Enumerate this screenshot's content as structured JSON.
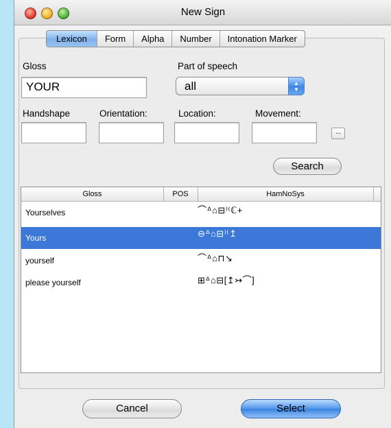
{
  "window": {
    "title": "New Sign"
  },
  "tabs": [
    "Lexicon",
    "Form",
    "Alpha",
    "Number",
    "Intonation Marker"
  ],
  "form": {
    "gloss_label": "Gloss",
    "gloss_value": "YOUR",
    "pos_label": "Part of speech",
    "pos_value": "all",
    "handshape_label": "Handshape",
    "orientation_label": "Orientation:",
    "location_label": "Location:",
    "movement_label": "Movement:",
    "ellipsis_label": "...",
    "search_label": "Search"
  },
  "table": {
    "columns": [
      "Gloss",
      "POS",
      "HamNoSys"
    ],
    "rows": [
      {
        "gloss": "Yourselves",
        "pos": "",
        "hamnosys": "⌒ᐞ⌂⊟⁾⁽ℂ+"
      },
      {
        "gloss": "Yours",
        "pos": "",
        "hamnosys": "⊖ᐞ⌂⊟⁾⁽↥"
      },
      {
        "gloss": "yourself",
        "pos": "",
        "hamnosys": "⌒ᐞ⌂⊓↘"
      },
      {
        "gloss": "please yourself",
        "pos": "",
        "hamnosys": "⊞ᐞ⌂⊟[↥↣⌒]"
      }
    ],
    "selected_row": 1
  },
  "buttons": {
    "cancel": "Cancel",
    "select": "Select"
  },
  "colors": {
    "selection": "#3b78d8",
    "background": "#b8e6f6"
  }
}
